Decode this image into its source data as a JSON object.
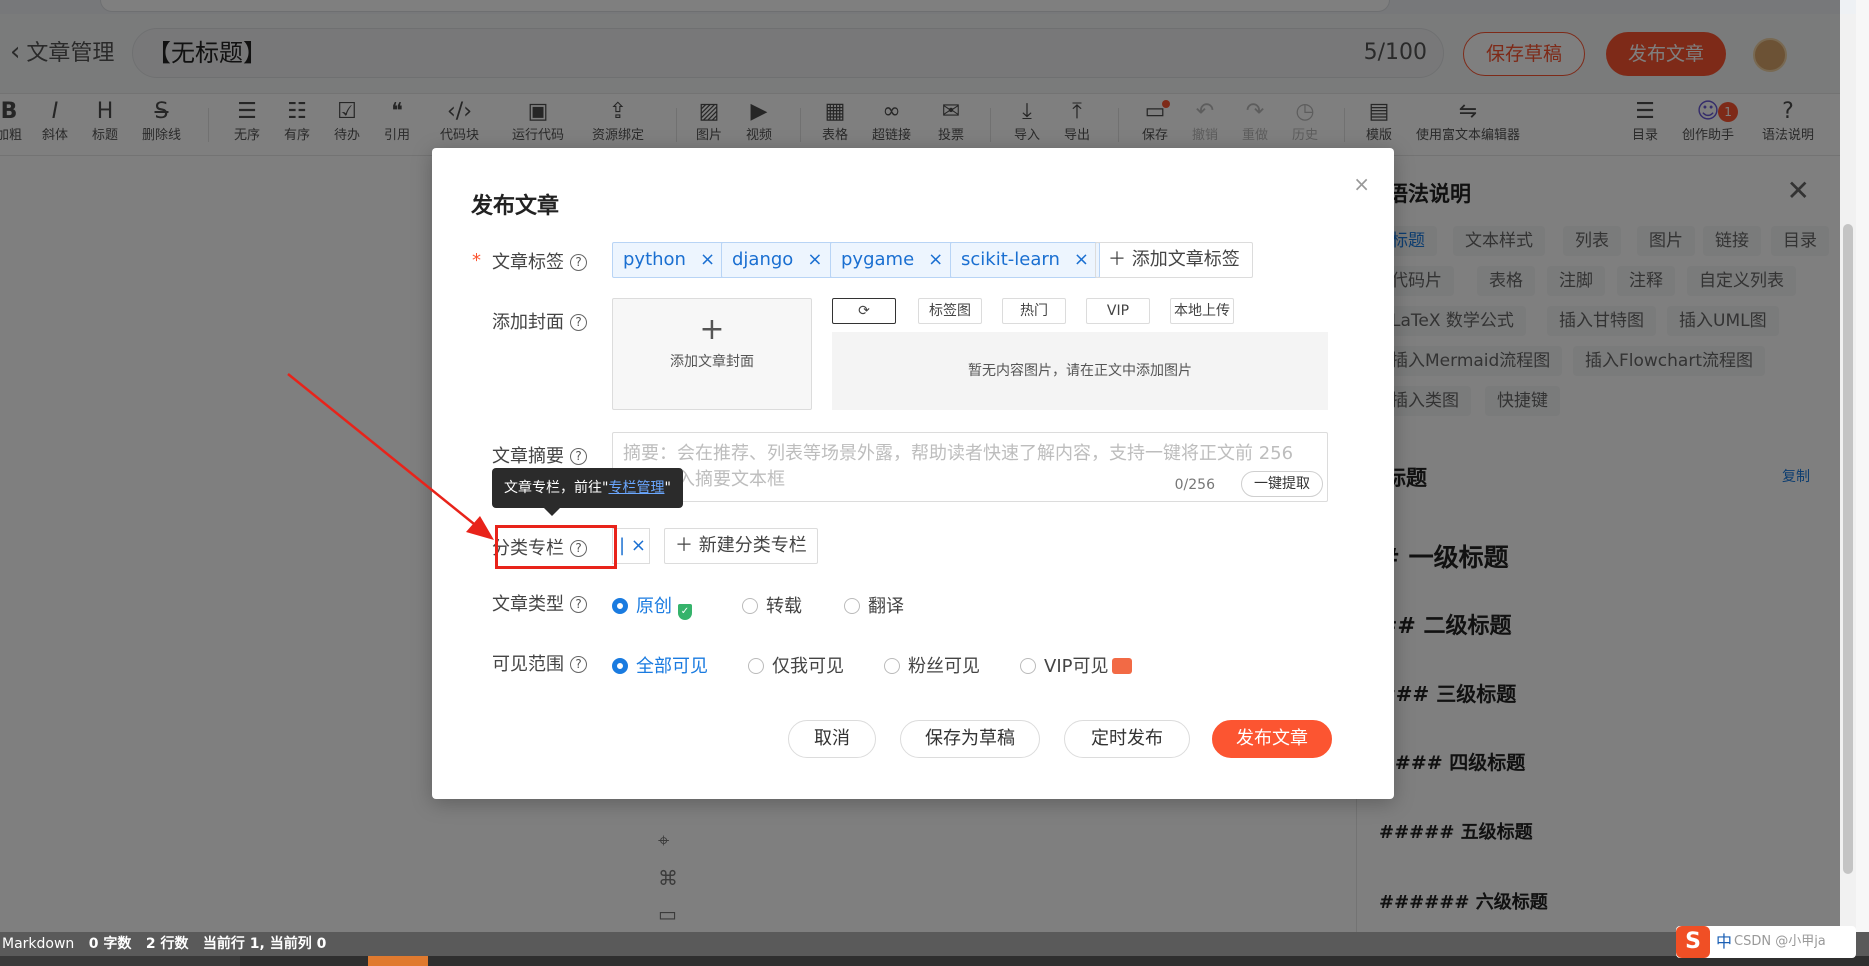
{
  "header": {
    "back_label": "文章管理",
    "title_value": "【无标题】",
    "title_count": "5/100",
    "save_draft": "保存草稿",
    "publish": "发布文章"
  },
  "toolbar": {
    "items": [
      {
        "icon": "B",
        "label": "加粗"
      },
      {
        "icon": "I",
        "label": "斜体"
      },
      {
        "icon": "H",
        "label": "标题"
      },
      {
        "icon": "S",
        "label": "删除线"
      },
      {
        "icon": "☰",
        "label": "无序"
      },
      {
        "icon": "☷",
        "label": "有序"
      },
      {
        "icon": "☑",
        "label": "待办"
      },
      {
        "icon": "❝",
        "label": "引用"
      },
      {
        "icon": "‹/›",
        "label": "代码块"
      },
      {
        "icon": "▣",
        "label": "运行代码"
      },
      {
        "icon": "⇪",
        "label": "资源绑定"
      },
      {
        "icon": "▨",
        "label": "图片"
      },
      {
        "icon": "▶",
        "label": "视频"
      },
      {
        "icon": "▦",
        "label": "表格"
      },
      {
        "icon": "∞",
        "label": "超链接"
      },
      {
        "icon": "✉",
        "label": "投票"
      },
      {
        "icon": "⤓",
        "label": "导入"
      },
      {
        "icon": "⤒",
        "label": "导出"
      },
      {
        "icon": "▭",
        "label": "保存"
      },
      {
        "icon": "↶",
        "label": "撤销"
      },
      {
        "icon": "↷",
        "label": "重做"
      },
      {
        "icon": "◷",
        "label": "历史"
      },
      {
        "icon": "▤",
        "label": "模版"
      },
      {
        "icon": "⇋",
        "label": "使用富文本编辑器"
      },
      {
        "icon": "☰",
        "label": "目录"
      },
      {
        "icon": "☺",
        "label": "创作助手"
      },
      {
        "icon": "?",
        "label": "语法说明"
      }
    ],
    "assistant_badge": "1"
  },
  "help": {
    "title": "语法说明",
    "chips": [
      "标题",
      "文本样式",
      "列表",
      "图片",
      "链接",
      "目录",
      "代码片",
      "表格",
      "注脚",
      "注释",
      "自定义列表",
      "LaTeX 数学公式",
      "插入甘特图",
      "插入UML图",
      "插入Mermaid流程图",
      "插入Flowchart流程图",
      "插入类图",
      "快捷键"
    ],
    "section": "标题",
    "copy": "复制",
    "headings": [
      "# 一级标题",
      "## 二级标题",
      "### 三级标题",
      "#### 四级标题",
      "##### 五级标题",
      "###### 六级标题"
    ]
  },
  "modal": {
    "title": "发布文章",
    "tags_label": "文章标签",
    "tags": [
      "python",
      "django",
      "pygame",
      "scikit-learn"
    ],
    "add_tag": "添加文章标签",
    "cover_label": "添加封面",
    "cover_add": "添加文章封面",
    "cover_tabs": [
      "标签图",
      "热门",
      "VIP",
      "本地上传"
    ],
    "cover_empty": "暂无内容图片，请在正文中添加图片",
    "summary_label": "文章摘要",
    "summary_placeholder": "摘要：会在推荐、列表等场景外露，帮助读者快速了解内容，支持一键将正文前 256 字符键入摘要文本框",
    "summary_count": "0/256",
    "summary_extract": "一键提取",
    "tooltip_prefix": "文章专栏，前往\"",
    "tooltip_link": "专栏管理",
    "tooltip_suffix": "\"",
    "column_label": "分类专栏",
    "column_input": "|",
    "new_column": "新建分类专栏",
    "type_label": "文章类型",
    "types": [
      "原创",
      "转载",
      "翻译"
    ],
    "visibility_label": "可见范围",
    "visibility": [
      "全部可见",
      "仅我可见",
      "粉丝可见",
      "VIP可见"
    ],
    "buttons": {
      "cancel": "取消",
      "draft": "保存为草稿",
      "schedule": "定时发布",
      "publish": "发布文章"
    }
  },
  "status": {
    "mode": "Markdown",
    "chars": "0 字数",
    "lines": "2 行数",
    "position": "当前行 1, 当前列 0"
  },
  "ime": {
    "lang": "中",
    "watermark": "CSDN @小甲ja"
  },
  "colors": {
    "accent": "#fc5531",
    "link": "#1a7be0",
    "annotation": "#e8231a"
  }
}
